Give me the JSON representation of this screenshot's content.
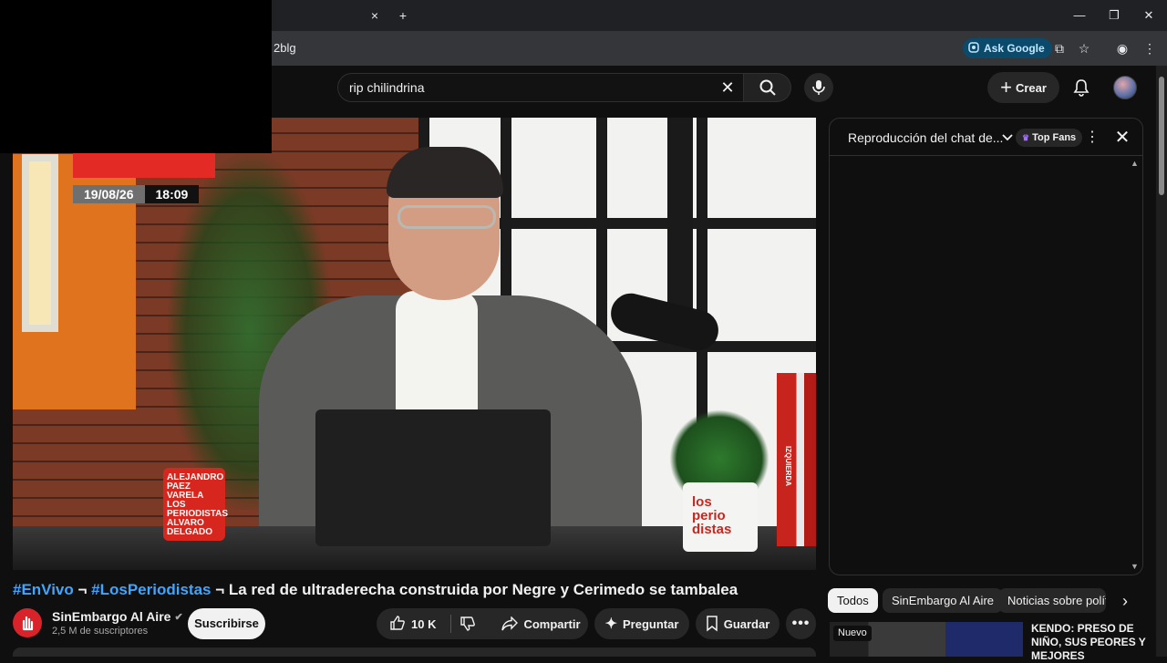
{
  "browser": {
    "tab_close": "×",
    "new_tab": "+",
    "url_fragment": "2blg",
    "ask_google": "Ask Google",
    "window": {
      "minimize": "—",
      "restore": "❐",
      "close": "✕"
    }
  },
  "header": {
    "search_value": "rip chilindrina",
    "create_label": "Crear"
  },
  "video": {
    "date": "19/08/26",
    "time": "18:09",
    "mug_text": "ALEJANDRO PAEZ VARELA LOS PERIODISTAS ALVARO DELGADO",
    "pot_text": "los perio distas",
    "book_text": "IZQUIERDA"
  },
  "info": {
    "title_tag1": "#EnVivo",
    "title_sep1": " ¬ ",
    "title_tag2": "#LosPeriodistas",
    "title_rest": " ¬ La red de ultraderecha construida por Negre y Cerimedo se tambalea",
    "channel_name": "SinEmbargo Al Aire",
    "subscribers": "2,5 M de suscriptores",
    "subscribe_label": "Suscribirse",
    "likes": "10 K",
    "share_label": "Compartir",
    "ask_label": "Preguntar",
    "save_label": "Guardar"
  },
  "chat": {
    "title": "Reproducción del chat de...",
    "top_fans": "Top Fans"
  },
  "chips": [
    "Todos",
    "SinEmbargo Al Aire",
    "Noticias sobre polít"
  ],
  "recommendation": {
    "badge": "Nuevo",
    "title": "KENDO: PRESO DE NIÑO, SUS PEORES Y MEJORES"
  },
  "colors": {
    "accent_blue": "#3ea6ff",
    "brand_red": "#d8232a"
  }
}
